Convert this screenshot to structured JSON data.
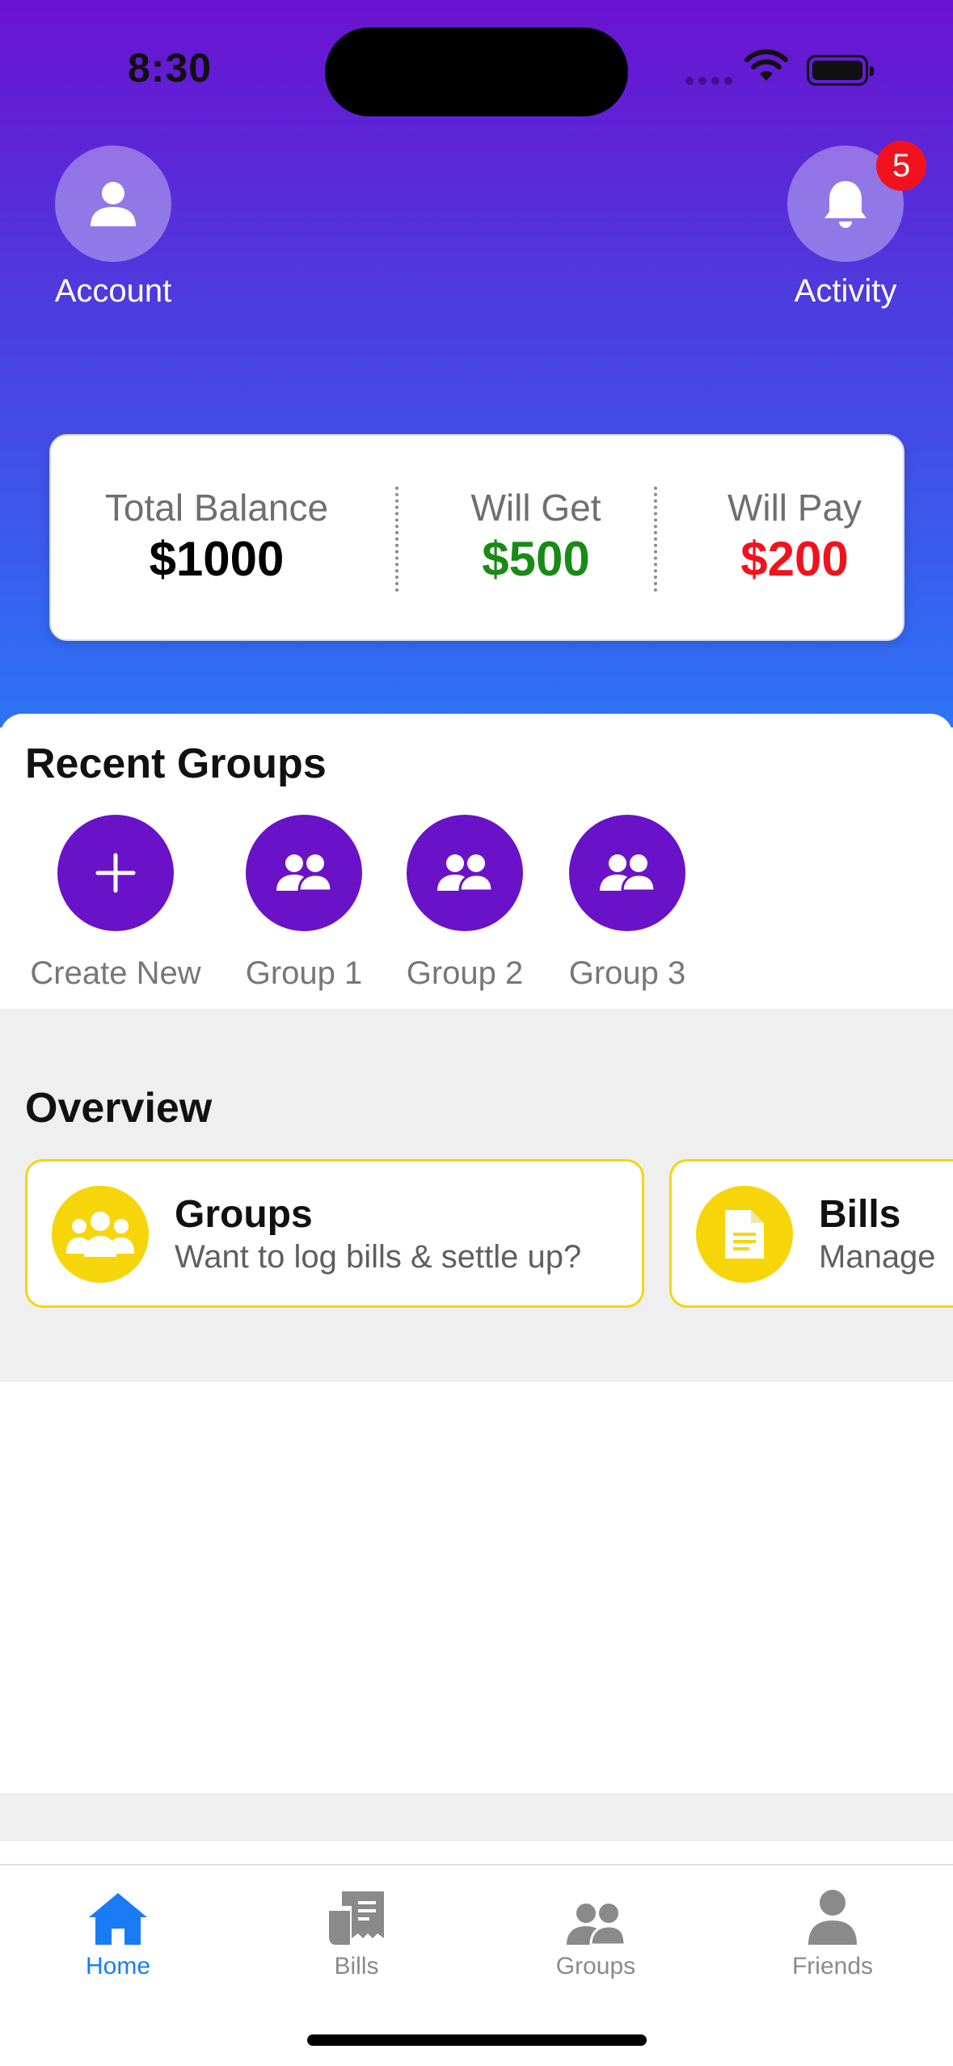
{
  "status_bar": {
    "time": "8:30"
  },
  "header": {
    "account": {
      "label": "Account",
      "icon": "person-icon"
    },
    "activity": {
      "label": "Activity",
      "icon": "bell-icon",
      "badge_count": "5"
    }
  },
  "balance": {
    "total": {
      "caption": "Total Balance",
      "value": "$1000",
      "color": "#000000"
    },
    "will_get": {
      "caption": "Will Get",
      "value": "$500",
      "color": "#1a8a17"
    },
    "will_pay": {
      "caption": "Will Pay",
      "value": "$200",
      "color": "#f2121e"
    }
  },
  "recent_groups": {
    "title": "Recent Groups",
    "create_label": "Create New",
    "groups": [
      {
        "label": "Group 1"
      },
      {
        "label": "Group 2"
      },
      {
        "label": "Group 3"
      }
    ]
  },
  "overview": {
    "title": "Overview",
    "cards": [
      {
        "title": "Groups",
        "subtitle": "Want to log bills & settle up?",
        "icon": "people-group-icon"
      },
      {
        "title": "Bills",
        "subtitle": "Manage",
        "icon": "document-icon"
      }
    ]
  },
  "tabbar": {
    "tabs": [
      {
        "label": "Home",
        "icon": "house-icon",
        "active": true
      },
      {
        "label": "Bills",
        "icon": "receipt-icon",
        "active": false
      },
      {
        "label": "Groups",
        "icon": "people-icon",
        "active": false
      },
      {
        "label": "Friends",
        "icon": "person-icon",
        "active": false
      }
    ]
  },
  "colors": {
    "accent_purple": "#6a12c8",
    "tab_active": "#1a7cf5",
    "overview_yellow": "#f7d50b"
  }
}
